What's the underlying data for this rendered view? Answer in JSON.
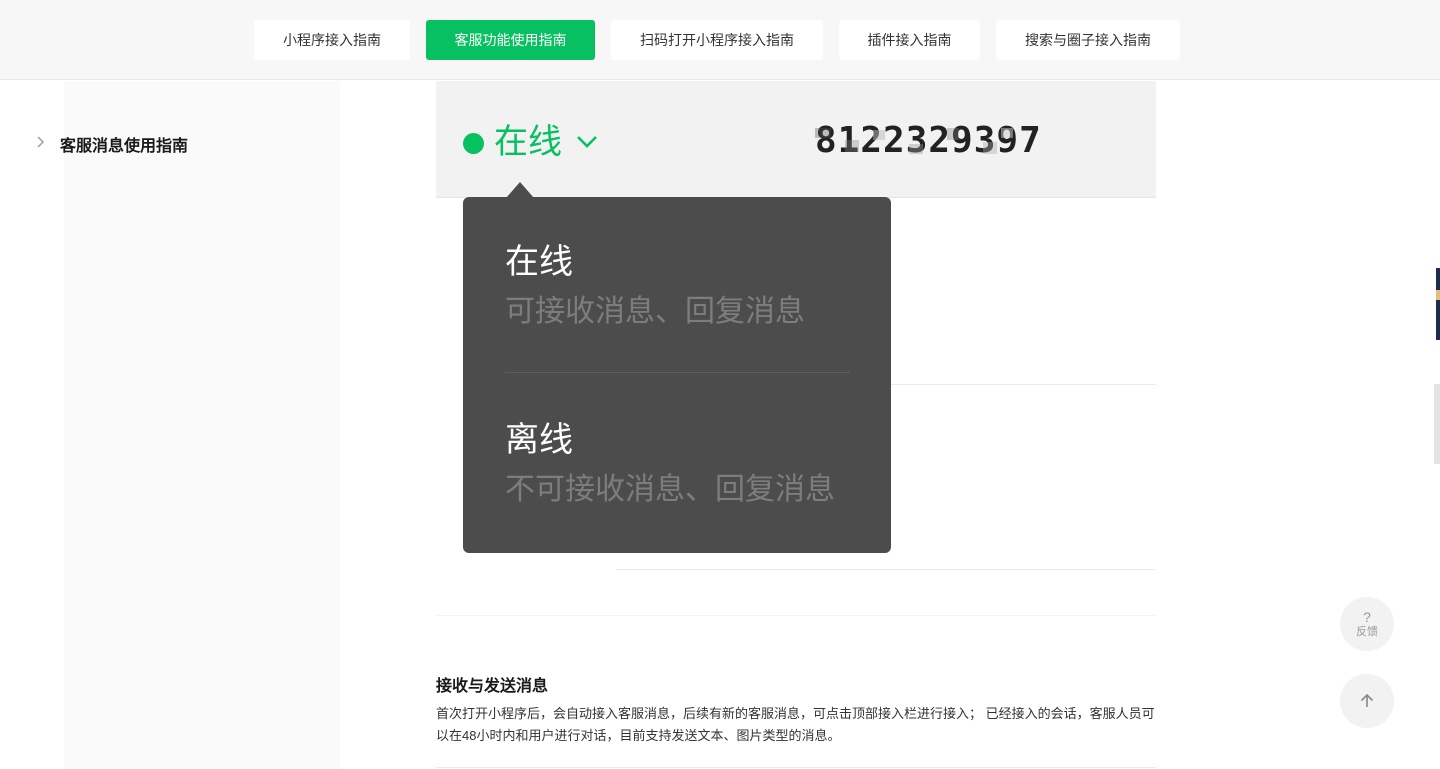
{
  "nav": {
    "tabs": [
      {
        "label": "小程序接入指南"
      },
      {
        "label": "客服功能使用指南",
        "active": true
      },
      {
        "label": "扫码打开小程序接入指南"
      },
      {
        "label": "插件接入指南"
      },
      {
        "label": "搜索与圈子接入指南"
      }
    ]
  },
  "sidebar": {
    "items": [
      {
        "label": "客服消息使用指南"
      }
    ]
  },
  "status_panel": {
    "status": "在线",
    "account_id": "8122329397"
  },
  "status_menu": {
    "options": [
      {
        "title": "在线",
        "description": "可接收消息、回复消息"
      },
      {
        "title": "离线",
        "description": "不可接收消息、回复消息"
      }
    ]
  },
  "article": {
    "section_title": "接收与发送消息",
    "paragraph": "首次打开小程序后，会自动接入客服消息，后续有新的客服消息，可点击顶部接入栏进行接入； 已经接入的会话，客服人员可以在48小时内和用户进行对话，目前支持发送文本、图片类型的消息。"
  },
  "floating": {
    "feedback_icon": "?",
    "feedback_label": "反馈",
    "back_to_top_icon": "arrow-up-icon"
  },
  "colors": {
    "accent": "#07c160",
    "popup_bg": "#4c4c4c",
    "topbar_bg": "#f7f7f7"
  }
}
